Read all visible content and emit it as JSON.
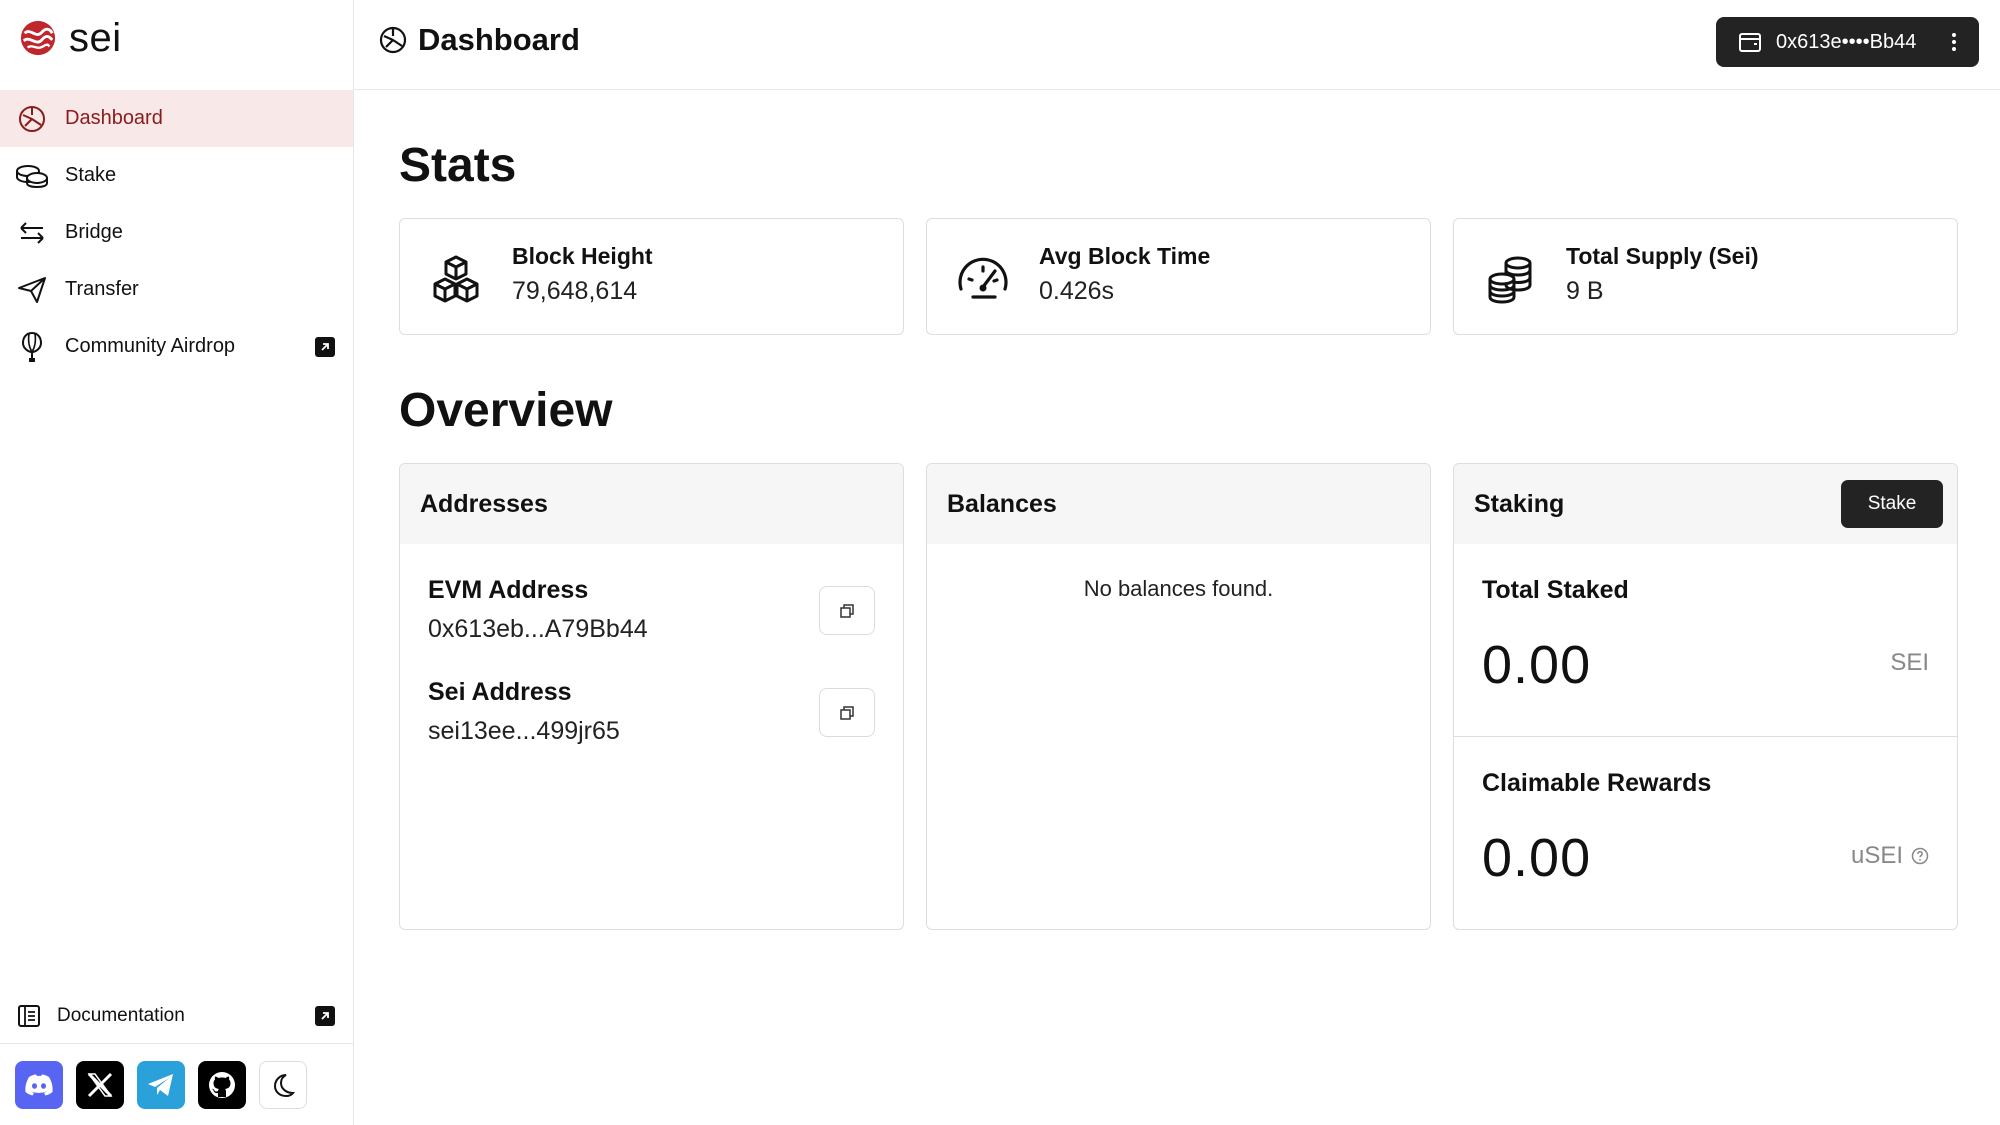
{
  "brand": {
    "name": "sei",
    "accent": "#c0262d"
  },
  "sidebar": {
    "items": [
      {
        "label": "Dashboard",
        "icon": "dashboard-icon",
        "active": true
      },
      {
        "label": "Stake",
        "icon": "coins-stack-icon"
      },
      {
        "label": "Bridge",
        "icon": "arrows-swap-icon"
      },
      {
        "label": "Transfer",
        "icon": "send-icon"
      },
      {
        "label": "Community Airdrop",
        "icon": "balloon-icon",
        "external": true
      }
    ],
    "documentation": {
      "label": "Documentation",
      "icon": "book-icon",
      "external": true
    },
    "socials": [
      {
        "name": "discord-icon",
        "color": "#5865f2"
      },
      {
        "name": "x-icon",
        "color": "#000000"
      },
      {
        "name": "telegram-icon",
        "color": "#2aa1da"
      },
      {
        "name": "github-icon",
        "color": "#000000"
      },
      {
        "name": "moon-icon",
        "color": "#ffffff"
      }
    ]
  },
  "header": {
    "title": "Dashboard",
    "wallet": "0x613e••••Bb44"
  },
  "stats": {
    "title": "Stats",
    "cards": [
      {
        "label": "Block Height",
        "value": "79,648,614",
        "icon": "cubes-icon"
      },
      {
        "label": "Avg Block Time",
        "value": "0.426s",
        "icon": "speedometer-icon"
      },
      {
        "label": "Total Supply (Sei)",
        "value": "9 B",
        "icon": "coins-icon"
      }
    ]
  },
  "overview": {
    "title": "Overview",
    "addresses": {
      "title": "Addresses",
      "evm": {
        "label": "EVM Address",
        "value": "0x613eb...A79Bb44"
      },
      "sei": {
        "label": "Sei Address",
        "value": "sei13ee...499jr65"
      }
    },
    "balances": {
      "title": "Balances",
      "empty": "No balances found."
    },
    "staking": {
      "title": "Staking",
      "button": "Stake",
      "total_staked": {
        "label": "Total Staked",
        "value": "0.00",
        "unit": "SEI"
      },
      "rewards": {
        "label": "Claimable Rewards",
        "value": "0.00",
        "unit": "uSEI"
      }
    }
  }
}
